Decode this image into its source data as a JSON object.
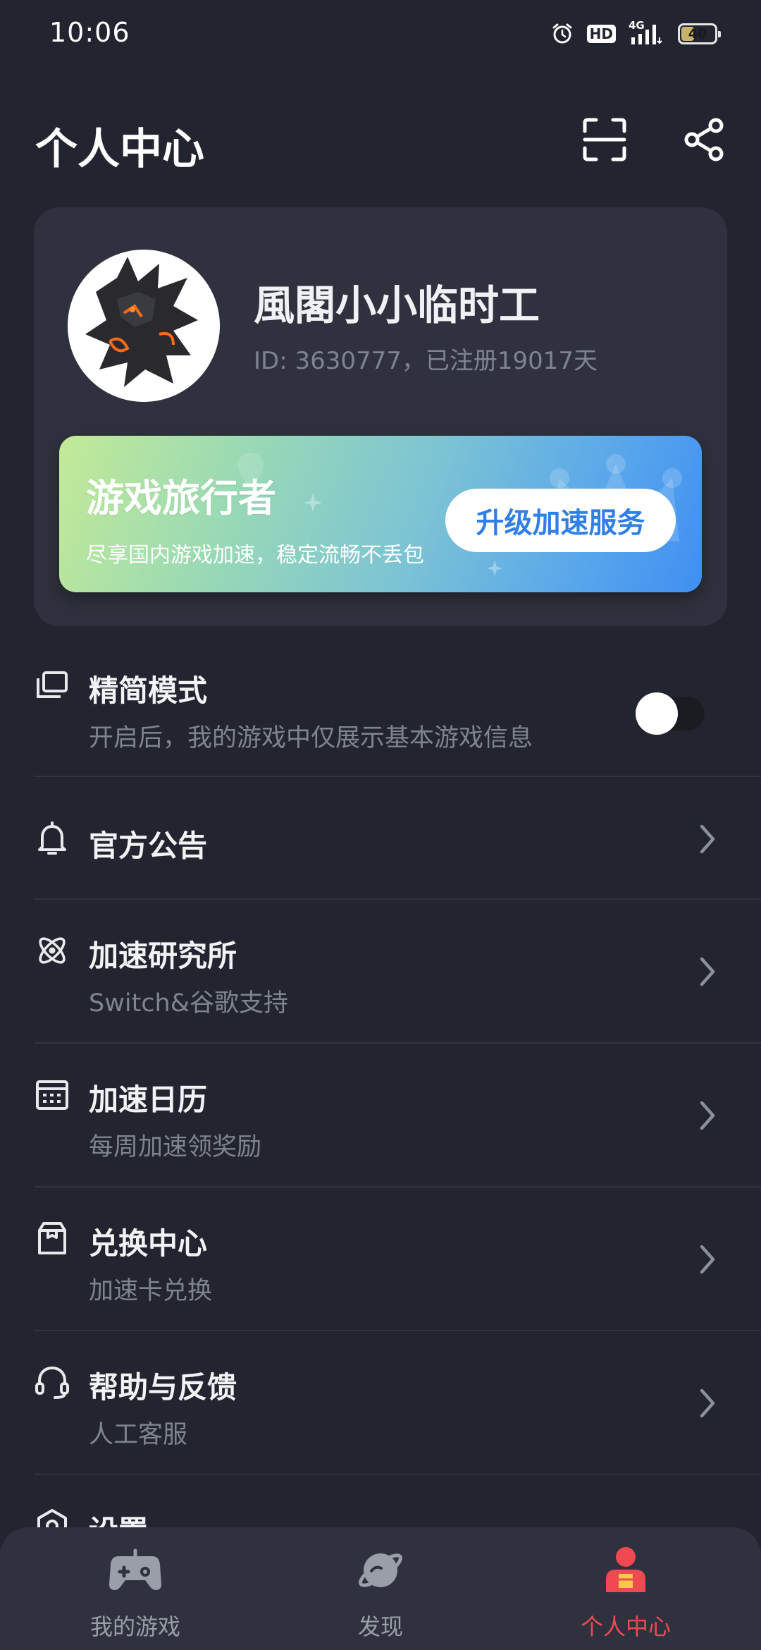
{
  "status_bar": {
    "time": "10:06",
    "hd": "HD",
    "network": "4G",
    "battery": "40",
    "battery_level": 0.4
  },
  "header": {
    "title": "个人中心"
  },
  "profile": {
    "username": "風閣小小临时工",
    "id_line": "ID: 3630777，已注册19017天"
  },
  "vip": {
    "title": "游戏旅行者",
    "subtitle": "尽享国内游戏加速，稳定流畅不丢包",
    "button": "升级加速服务"
  },
  "menu": {
    "simple_mode": {
      "title": "精简模式",
      "subtitle": "开启后，我的游戏中仅展示基本游戏信息",
      "toggle_on": false
    },
    "items": [
      {
        "title": "官方公告",
        "subtitle": "",
        "icon": "bell-icon"
      },
      {
        "title": "加速研究所",
        "subtitle": "Switch&谷歌支持",
        "icon": "atom-icon"
      },
      {
        "title": "加速日历",
        "subtitle": "每周加速领奖励",
        "icon": "calendar-icon"
      },
      {
        "title": "兑换中心",
        "subtitle": "加速卡兑换",
        "icon": "gift-box-icon"
      },
      {
        "title": "帮助与反馈",
        "subtitle": "人工客服",
        "icon": "headset-icon"
      },
      {
        "title": "设置",
        "subtitle": "",
        "icon": "settings-icon"
      }
    ]
  },
  "bottom_nav": [
    {
      "label": "我的游戏",
      "icon": "gamepad-icon",
      "active": false
    },
    {
      "label": "发现",
      "icon": "planet-icon",
      "active": false
    },
    {
      "label": "个人中心",
      "icon": "profile-icon",
      "active": true
    }
  ],
  "colors": {
    "background": "#22252f",
    "card": "#2f323e",
    "accent_red": "#ef4a52",
    "vip_button_text": "#2f7fe6"
  }
}
